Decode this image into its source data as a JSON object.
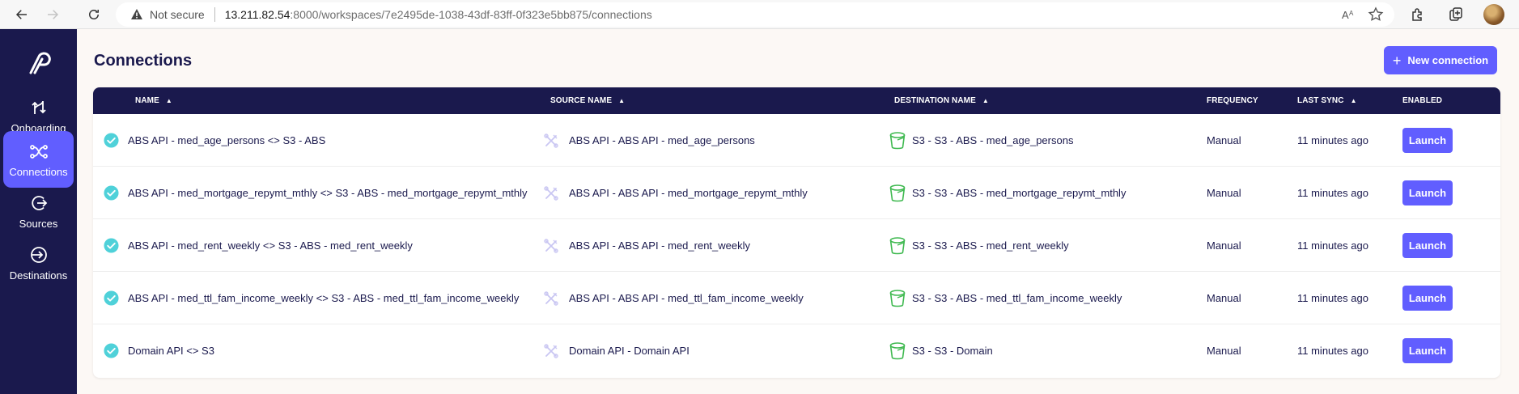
{
  "browser": {
    "not_secure": "Not secure",
    "url_host": "13.211.82.54",
    "url_rest": ":8000/workspaces/7e2495de-1038-43df-83ff-0f323e5bb875/connections"
  },
  "sidebar": {
    "items": [
      {
        "label": "Onboarding",
        "icon": "onboarding-icon"
      },
      {
        "label": "Connections",
        "icon": "connections-icon",
        "active": true
      },
      {
        "label": "Sources",
        "icon": "sources-icon"
      },
      {
        "label": "Destinations",
        "icon": "destinations-icon"
      }
    ]
  },
  "page": {
    "title": "Connections",
    "new_connection_label": "New connection"
  },
  "table": {
    "headers": {
      "name": "Name",
      "source_name": "Source Name",
      "destination_name": "Destination Name",
      "frequency": "Frequency",
      "last_sync": "Last Sync",
      "enabled": "Enabled"
    },
    "rows": [
      {
        "name": "ABS API - med_age_persons <> S3 - ABS",
        "source": "ABS API - ABS API - med_age_persons",
        "destination": "S3 - S3 - ABS - med_age_persons",
        "frequency": "Manual",
        "last_sync": "11 minutes ago",
        "action": "Launch"
      },
      {
        "name": "ABS API - med_mortgage_repymt_mthly <> S3 - ABS - med_mortgage_repymt_mthly",
        "source": "ABS API - ABS API - med_mortgage_repymt_mthly",
        "destination": "S3 - S3 - ABS - med_mortgage_repymt_mthly",
        "frequency": "Manual",
        "last_sync": "11 minutes ago",
        "action": "Launch"
      },
      {
        "name": "ABS API - med_rent_weekly <> S3 - ABS - med_rent_weekly",
        "source": "ABS API - ABS API - med_rent_weekly",
        "destination": "S3 - S3 - ABS - med_rent_weekly",
        "frequency": "Manual",
        "last_sync": "11 minutes ago",
        "action": "Launch"
      },
      {
        "name": "ABS API - med_ttl_fam_income_weekly <> S3 - ABS - med_ttl_fam_income_weekly",
        "source": "ABS API - ABS API - med_ttl_fam_income_weekly",
        "destination": "S3 - S3 - ABS - med_ttl_fam_income_weekly",
        "frequency": "Manual",
        "last_sync": "11 minutes ago",
        "action": "Launch"
      },
      {
        "name": "Domain API <> S3",
        "source": "Domain API - Domain API",
        "destination": "S3 - S3 - Domain",
        "frequency": "Manual",
        "last_sync": "11 minutes ago",
        "action": "Launch"
      }
    ]
  },
  "colors": {
    "sidebar_bg": "#1a194d",
    "accent": "#615eff",
    "check": "#4fd1d9",
    "destination_icon": "#3fb950"
  }
}
